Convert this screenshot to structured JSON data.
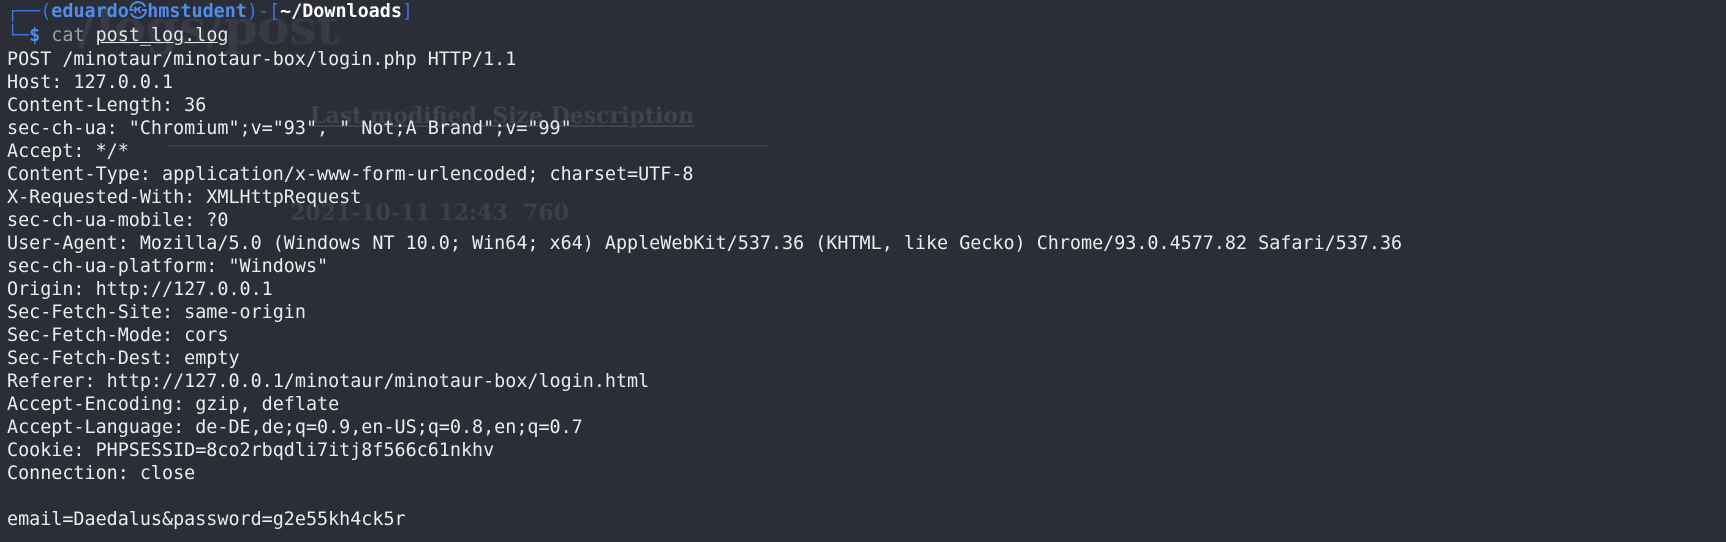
{
  "background_ghost": {
    "title": "/logs/post",
    "columns": "Last modified  Size Description",
    "row": "2021-10-11 12:43  760"
  },
  "prompt": {
    "corner_top": "┌──(",
    "user": "eduardo",
    "skull_glyph": "㉿",
    "host": "hmstudent",
    "sep": ")-[",
    "cwd": "~/Downloads",
    "close": "]",
    "corner_bottom": "└─",
    "dollar": "$",
    "command": "cat",
    "argument": "post_log.log"
  },
  "output_lines": [
    "POST /minotaur/minotaur-box/login.php HTTP/1.1",
    "Host: 127.0.0.1",
    "Content-Length: 36",
    "sec-ch-ua: \"Chromium\";v=\"93\", \" Not;A Brand\";v=\"99\"",
    "Accept: */*",
    "Content-Type: application/x-www-form-urlencoded; charset=UTF-8",
    "X-Requested-With: XMLHttpRequest",
    "sec-ch-ua-mobile: ?0",
    "User-Agent: Mozilla/5.0 (Windows NT 10.0; Win64; x64) AppleWebKit/537.36 (KHTML, like Gecko) Chrome/93.0.4577.82 Safari/537.36",
    "sec-ch-ua-platform: \"Windows\"",
    "Origin: http://127.0.0.1",
    "Sec-Fetch-Site: same-origin",
    "Sec-Fetch-Mode: cors",
    "Sec-Fetch-Dest: empty",
    "Referer: http://127.0.0.1/minotaur/minotaur-box/login.html",
    "Accept-Encoding: gzip, deflate",
    "Accept-Language: de-DE,de;q=0.9,en-US;q=0.8,en;q=0.7",
    "Cookie: PHPSESSID=8co2rbqdli7itj8f566c61nkhv",
    "Connection: close",
    "",
    "email=Daedalus&password=g2e55kh4ck5r"
  ],
  "colors": {
    "background": "#2b2e37",
    "prompt_blue": "#4f8df0",
    "text": "#ececec"
  }
}
